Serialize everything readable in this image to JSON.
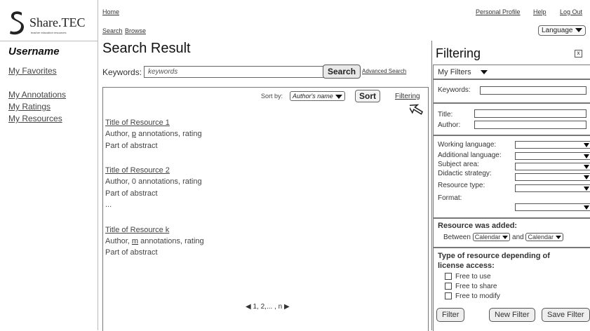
{
  "logo": {
    "name": "Share.TEC",
    "tagline": "teacher education resources"
  },
  "nav": {
    "home": "Home",
    "search": "Search",
    "browse": "Browse",
    "personal_profile": "Personal Profile",
    "help": "Help",
    "logout": "Log Out",
    "language": "Language"
  },
  "sidebar": {
    "username": "Username",
    "favorites": "My Favorites",
    "annotations": "My Annotations",
    "ratings": "My Ratings",
    "resources": "My Resources"
  },
  "search": {
    "title": "Search Result",
    "keywords_label": "Keywords:",
    "keywords_value": "keywords",
    "search_button": "Search",
    "advanced": "Advanced Search",
    "sort_by": "Sort by:",
    "sort_option": "Author's name",
    "sort_button": "Sort",
    "filtering_link": "Filtering"
  },
  "results": [
    {
      "title": "Title of Resource 1",
      "author_pre": "Author, ",
      "count": "p",
      "author_post": " annotations, rating",
      "abstract": "Part of abstract"
    },
    {
      "title": "Title of Resource 2",
      "author_pre": "Author, 0 annotations, rating",
      "count": "",
      "author_post": "",
      "abstract": "Part of abstract"
    },
    {
      "title": "Title of Resource k",
      "author_pre": "Author, ",
      "count": "m",
      "author_post": " annotations, rating",
      "abstract": "Part of abstract"
    }
  ],
  "ellipsis": "...",
  "pager": "1, 2,... , n",
  "filtering": {
    "title": "Filtering",
    "close": "x",
    "my_filters": "My Filters",
    "keywords": "Keywords:",
    "title_label": "Title:",
    "author_label": "Author:",
    "working_language": "Working language:",
    "additional_language": "Additional language:",
    "subject_area": "Subject area:",
    "didactic_strategy": "Didactic strategy:",
    "resource_type": "Resource type:",
    "format": "Format:",
    "added_heading": "Resource was added:",
    "between": "Between",
    "calendar": "Calendar",
    "and": "and",
    "license_heading_1": "Type of resource depending of",
    "license_heading_2": "license access:",
    "free_use": "Free to use",
    "free_share": "Free to share",
    "free_modify": "Free to modify",
    "filter_btn": "Filter",
    "new_filter_btn": "New Filter",
    "save_filter_btn": "Save Filter"
  }
}
